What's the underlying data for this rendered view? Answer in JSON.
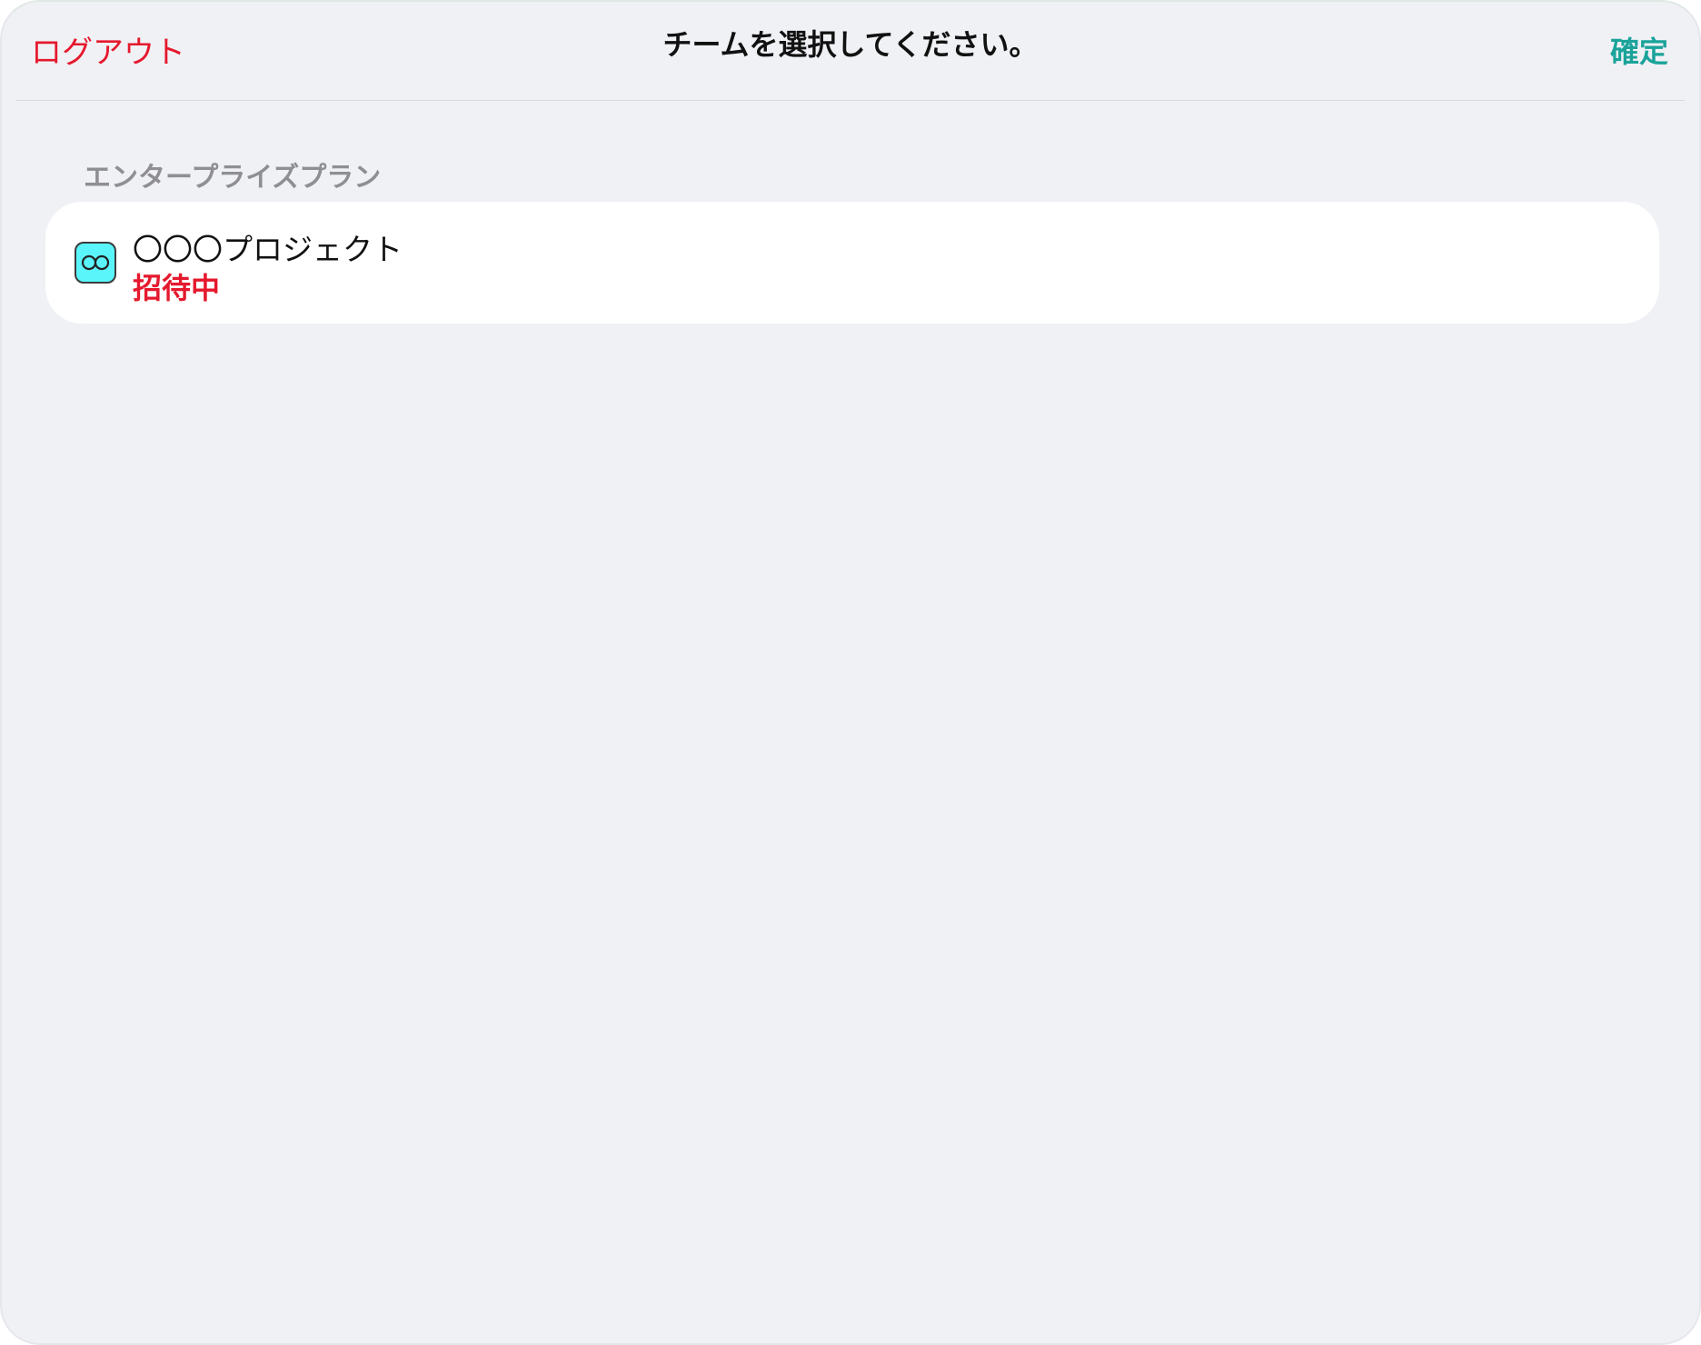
{
  "nav": {
    "logout_label": "ログアウト",
    "title": "チームを選択してください。",
    "confirm_label": "確定"
  },
  "section": {
    "header": "エンタープライズプラン"
  },
  "teams": [
    {
      "name": "〇〇〇プロジェクト",
      "status": "招待中",
      "icon": "team-avatar-icon"
    }
  ],
  "colors": {
    "destructive": "#e5192d",
    "accent": "#1ba39a",
    "background": "#f0f1f5",
    "card": "#ffffff",
    "icon_fill": "#5af5fa"
  }
}
